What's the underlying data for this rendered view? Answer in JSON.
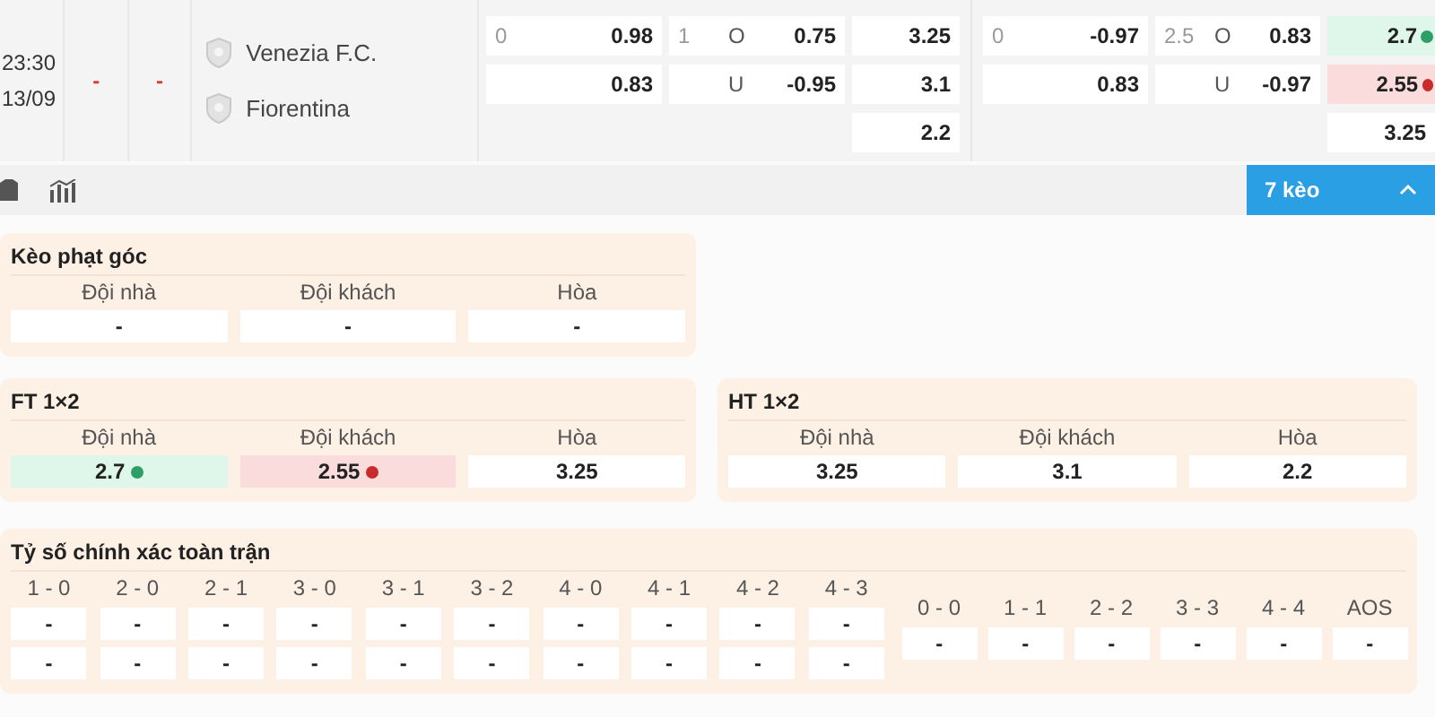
{
  "match": {
    "time": "23:30",
    "date": "13/09",
    "score_ft": "-",
    "score_ht": "-",
    "teams": [
      {
        "name": "Venezia F.C."
      },
      {
        "name": "Fiorentina"
      }
    ]
  },
  "odds": [
    {
      "rows": [
        {
          "line": "0",
          "value": "0.98"
        },
        {
          "value": "0.83"
        }
      ]
    },
    {
      "rows": [
        {
          "line": "1",
          "side": "O",
          "value": "0.75"
        },
        {
          "side": "U",
          "value": "-0.95"
        }
      ]
    },
    {
      "rows": [
        {
          "value": "3.25"
        },
        {
          "value": "3.1"
        },
        {
          "value": "2.2"
        }
      ]
    },
    {
      "rows": [
        {
          "line": "0",
          "value": "-0.97"
        },
        {
          "value": "0.83"
        }
      ]
    },
    {
      "rows": [
        {
          "line": "2.5",
          "side": "O",
          "value": "0.83"
        },
        {
          "side": "U",
          "value": "-0.97"
        }
      ]
    },
    {
      "rows": [
        {
          "value": "2.7",
          "up": true,
          "down": false
        },
        {
          "value": "2.55",
          "up": false,
          "down": true
        },
        {
          "value": "3.25",
          "up": false,
          "down": false
        }
      ]
    }
  ],
  "more_button": {
    "label": "7 kèo",
    "expanded": true
  },
  "panels": [
    {
      "title": "Kèo phạt góc",
      "items": [
        {
          "label": "Đội nhà",
          "value": "-"
        },
        {
          "label": "Đội khách",
          "value": "-"
        },
        {
          "label": "Hòa",
          "value": "-"
        }
      ]
    },
    {
      "title": "FT 1×2",
      "items": [
        {
          "label": "Đội nhà",
          "value": "2.7",
          "up": true,
          "down": false
        },
        {
          "label": "Đội khách",
          "value": "2.55",
          "up": false,
          "down": true
        },
        {
          "label": "Hòa",
          "value": "3.25",
          "up": false,
          "down": false
        }
      ]
    },
    {
      "title": "HT 1×2",
      "items": [
        {
          "label": "Đội nhà",
          "value": "3.25"
        },
        {
          "label": "Đội khách",
          "value": "3.1"
        },
        {
          "label": "Hòa",
          "value": "2.2"
        }
      ]
    }
  ],
  "correct_score": {
    "title": "Tỷ số chính xác toàn trận",
    "scores": [
      {
        "label": "1 - 0",
        "values": [
          "-",
          "-"
        ]
      },
      {
        "label": "2 - 0",
        "values": [
          "-",
          "-"
        ]
      },
      {
        "label": "2 - 1",
        "values": [
          "-",
          "-"
        ]
      },
      {
        "label": "3 - 0",
        "values": [
          "-",
          "-"
        ]
      },
      {
        "label": "3 - 1",
        "values": [
          "-",
          "-"
        ]
      },
      {
        "label": "3 - 2",
        "values": [
          "-",
          "-"
        ]
      },
      {
        "label": "4 - 0",
        "values": [
          "-",
          "-"
        ]
      },
      {
        "label": "4 - 1",
        "values": [
          "-",
          "-"
        ]
      },
      {
        "label": "4 - 2",
        "values": [
          "-",
          "-"
        ]
      },
      {
        "label": "4 - 3",
        "values": [
          "-",
          "-"
        ]
      }
    ],
    "draws": [
      {
        "label": "0 - 0",
        "value": "-"
      },
      {
        "label": "1 - 1",
        "value": "-"
      },
      {
        "label": "2 - 2",
        "value": "-"
      },
      {
        "label": "3 - 3",
        "value": "-"
      },
      {
        "label": "4 - 4",
        "value": "-"
      },
      {
        "label": "AOS",
        "value": "-"
      }
    ]
  }
}
